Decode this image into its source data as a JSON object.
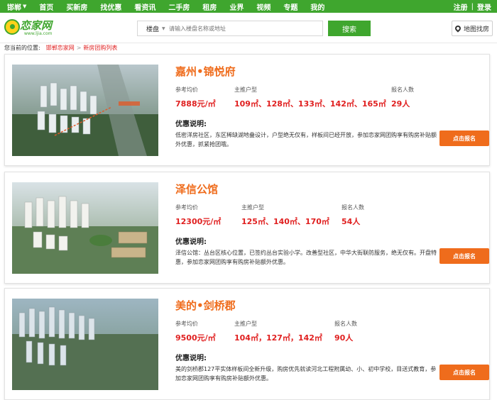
{
  "topnav": {
    "city": "邯郸",
    "items": [
      "首页",
      "买新房",
      "找优惠",
      "看资讯",
      "二手房",
      "租房",
      "业界",
      "视频",
      "专题",
      "我的"
    ],
    "login": "注册",
    "register": "登录"
  },
  "header": {
    "logo_text": "恋家网",
    "logo_domain": "www.ljia.com",
    "search_type": "楼盘",
    "search_placeholder": "请输入楼盘名称或地址",
    "search_button": "搜索",
    "map_button": "地图找房"
  },
  "breadcrumb": {
    "label": "您当前的位置:",
    "home": "邯郸恋家网",
    "separator": ">",
    "current": "新房团购列表"
  },
  "labels": {
    "avg_price": "参考均价",
    "main_types": "主推户型",
    "signups": "报名人数",
    "deal_title": "优惠说明:",
    "apply": "点击报名"
  },
  "listings": [
    {
      "name": "嘉州•锦悦府",
      "price": "7888元/㎡",
      "types": "109㎡、128㎡、133㎡、142㎡、165㎡",
      "signups": "29人",
      "description": "低密洋房社区，东区稀缺湖地叠设计，户型绝无仅有，样板间已经开放，参加恋家网团购享有购房补贴额外优惠，抓紧抢团哦。"
    },
    {
      "name": "泽信公馆",
      "price": "12300元/㎡",
      "types": "125㎡、140㎡、170㎡",
      "signups": "54人",
      "description": "泽信公馆：丛台区核心位置，已签约丛台实验小学。改善型社区，中华大街联防服务，绝无仅有。开盘特惠，参加恋家网团购享有购房补贴额外优惠。"
    },
    {
      "name": "美的•剑桥郡",
      "price": "9500元/㎡",
      "types": "104㎡，127㎡，142㎡",
      "signups": "90人",
      "description": "美的剑桥郡127平实体样板间全新升级，购房优先就读河北工程附属幼、小、初中学校，目送式教育，参加恋家网团购享有购房补贴额外优惠。"
    }
  ]
}
